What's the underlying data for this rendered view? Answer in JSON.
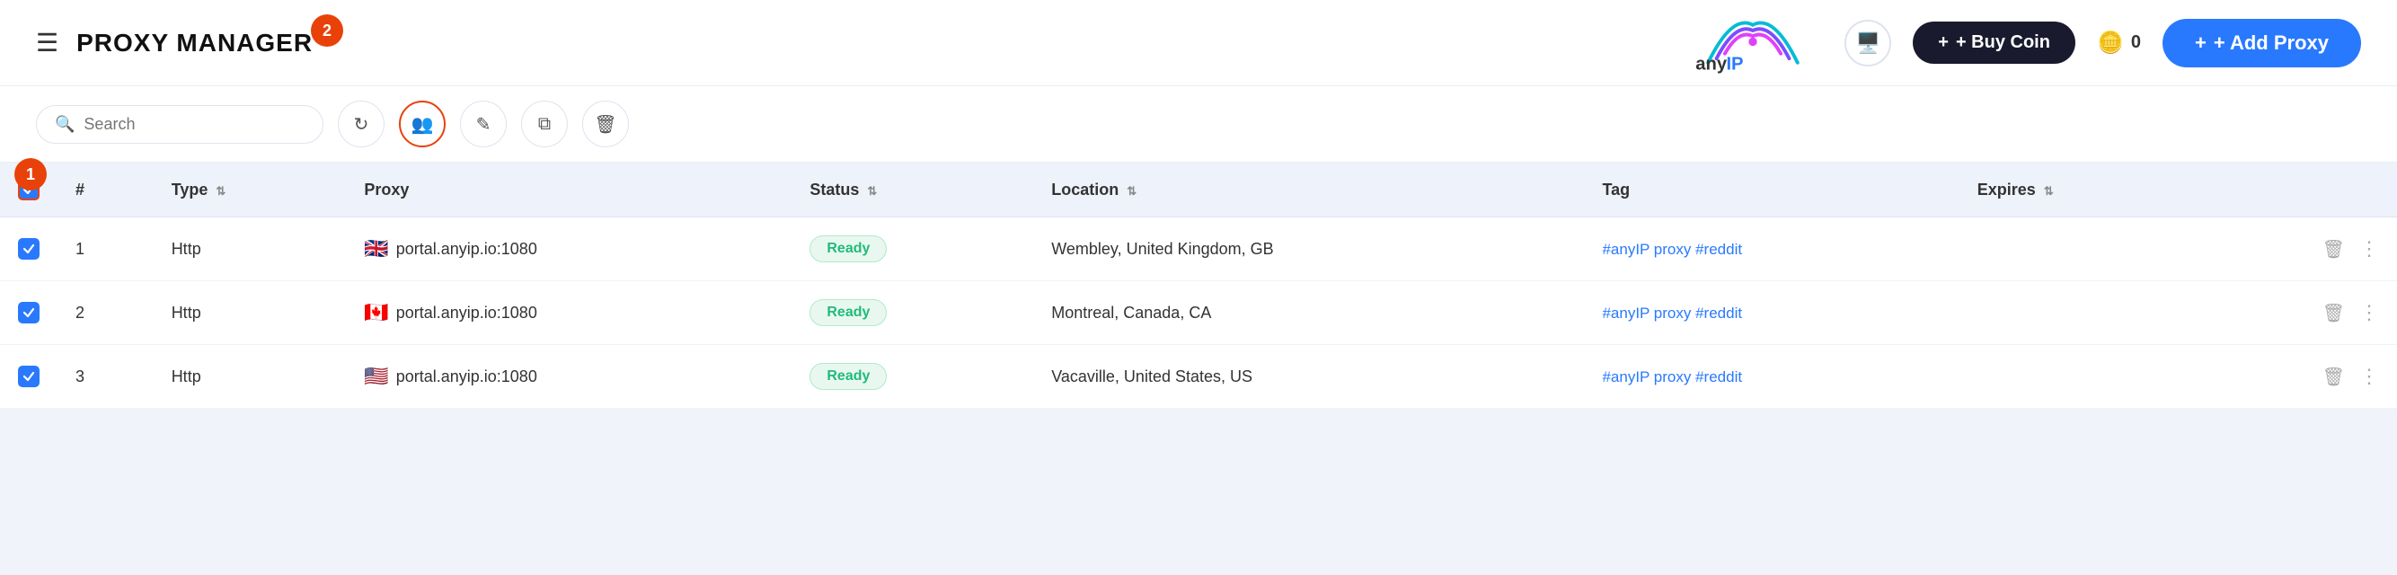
{
  "header": {
    "menu_icon": "☰",
    "title": "PROXY MANAGER",
    "notification_count": "2",
    "buy_coin_label": "+ Buy Coin",
    "coin_balance": "0",
    "add_proxy_label": "+ Add Proxy"
  },
  "toolbar": {
    "search_placeholder": "Search",
    "refresh_icon": "↻",
    "group_icon": "👥",
    "edit_icon": "✎",
    "copy_icon": "⧉",
    "delete_icon": "🗑"
  },
  "table": {
    "columns": [
      "#",
      "Type",
      "Proxy",
      "Status",
      "Location",
      "Tag",
      "Expires"
    ],
    "rows": [
      {
        "id": 1,
        "type": "Http",
        "flag": "🇬🇧",
        "proxy": "portal.anyip.io:1080",
        "status": "Ready",
        "location": "Wembley, United Kingdom, GB",
        "tag": "#anyIP proxy #reddit"
      },
      {
        "id": 2,
        "type": "Http",
        "flag": "🇨🇦",
        "proxy": "portal.anyip.io:1080",
        "status": "Ready",
        "location": "Montreal, Canada, CA",
        "tag": "#anyIP proxy #reddit"
      },
      {
        "id": 3,
        "type": "Http",
        "flag": "🇺🇸",
        "proxy": "portal.anyip.io:1080",
        "status": "Ready",
        "location": "Vacaville, United States, US",
        "tag": "#anyIP proxy #reddit"
      }
    ]
  },
  "steps": {
    "step1_label": "1",
    "step2_label": "2"
  }
}
